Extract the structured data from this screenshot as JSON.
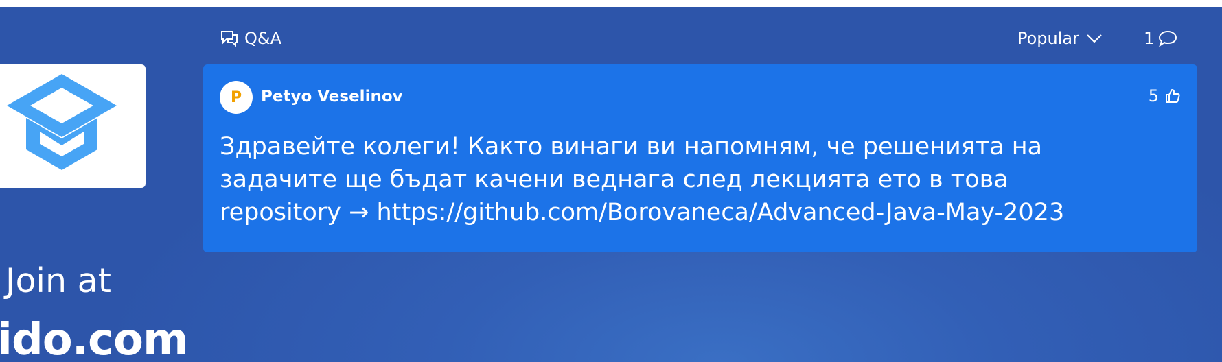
{
  "sidebar": {
    "join_prefix": "Join at",
    "site": "ido.com",
    "logo_icon": "graduation-cap-icon"
  },
  "header": {
    "section_icon": "chat-bubbles-icon",
    "section_label": "Q&A",
    "sort_label": "Popular",
    "sort_icon": "chevron-down-icon",
    "comment_count": "1",
    "comment_icon": "speech-bubble-icon"
  },
  "question": {
    "author_initial": "P",
    "author_name": "Petyo Veselinov",
    "likes": "5",
    "like_icon": "thumbs-up-icon",
    "text_lines": [
      "Здравейте колеги! Както винаги ви напомням, че решенията на",
      "задачите ще бъдат качени веднага след лекцията ето в това",
      "repository → https://github.com/Borovaneca/Advanced-Java-May-2023"
    ]
  },
  "colors": {
    "background": "#2f58ad",
    "card": "#1c73e8",
    "logo_blue": "#47a4f5",
    "avatar_initial": "#f2a100"
  }
}
